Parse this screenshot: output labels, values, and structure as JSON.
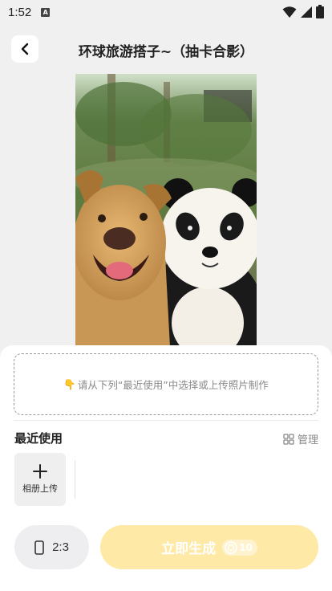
{
  "status_bar": {
    "time": "1:52",
    "notification_letter": "A"
  },
  "header": {
    "title": "环球旅游搭子~（抽卡合影）"
  },
  "upload": {
    "emoji": "👇",
    "hint": "请从下列“最近使用”中选择或上传照片制作"
  },
  "recent": {
    "title": "最近使用",
    "manage_label": "管理",
    "album_upload_label": "相册上传"
  },
  "footer": {
    "ratio_label": "2:3",
    "generate_label": "立即生成",
    "cost": "10"
  },
  "colors": {
    "generate_bg": "#feeaa6",
    "sheet_bg": "#ffffff",
    "page_bg": "#f0f0f0"
  }
}
